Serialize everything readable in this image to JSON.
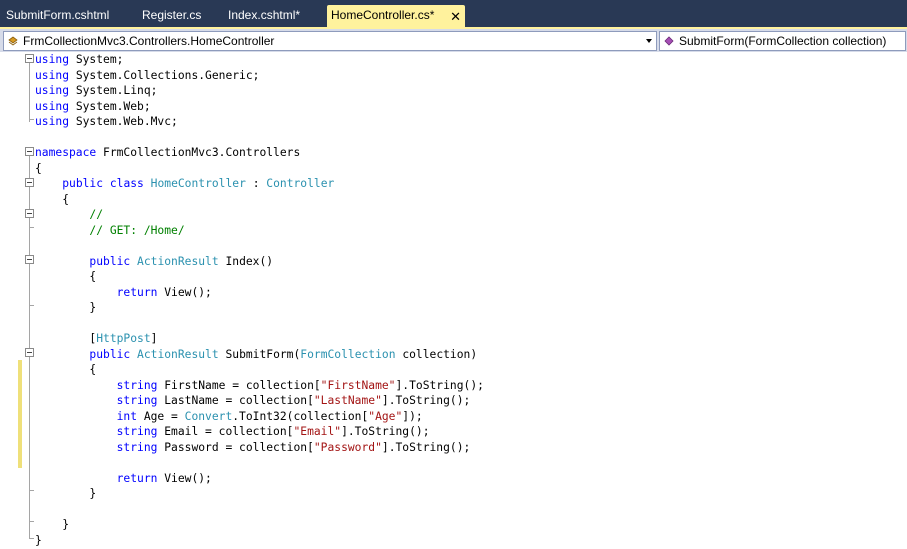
{
  "tabs": [
    {
      "label": "SubmitForm.cshtml",
      "active": false
    },
    {
      "label": "Register.cs",
      "active": false
    },
    {
      "label": "Index.cshtml*",
      "active": false
    },
    {
      "label": "HomeController.cs*",
      "active": true
    }
  ],
  "tab_close_glyph": "✕",
  "navbar": {
    "type_combo": "FrmCollectionMvc3.Controllers.HomeController",
    "member_combo": "SubmitForm(FormCollection collection)"
  },
  "icons": {
    "type_combo": "class-icon",
    "member_combo": "method-icon"
  },
  "colors": {
    "keyword": "#0000ff",
    "type": "#2b91af",
    "comment": "#008000",
    "string": "#a31515",
    "active_tab": "#fff29d",
    "tab_strip": "#293955"
  },
  "code_lines": [
    [
      {
        "t": "using",
        "c": "kw"
      },
      {
        "t": " System;"
      }
    ],
    [
      {
        "t": "using",
        "c": "kw"
      },
      {
        "t": " System.Collections.Generic;"
      }
    ],
    [
      {
        "t": "using",
        "c": "kw"
      },
      {
        "t": " System.Linq;"
      }
    ],
    [
      {
        "t": "using",
        "c": "kw"
      },
      {
        "t": " System.Web;"
      }
    ],
    [
      {
        "t": "using",
        "c": "kw"
      },
      {
        "t": " System.Web.Mvc;"
      }
    ],
    [],
    [
      {
        "t": "namespace",
        "c": "kw"
      },
      {
        "t": " FrmCollectionMvc3.Controllers"
      }
    ],
    [
      {
        "t": "{"
      }
    ],
    [
      {
        "t": "    "
      },
      {
        "t": "public",
        "c": "kw"
      },
      {
        "t": " "
      },
      {
        "t": "class",
        "c": "kw"
      },
      {
        "t": " "
      },
      {
        "t": "HomeController",
        "c": "ty"
      },
      {
        "t": " : "
      },
      {
        "t": "Controller",
        "c": "ty"
      }
    ],
    [
      {
        "t": "    {"
      }
    ],
    [
      {
        "t": "        "
      },
      {
        "t": "//",
        "c": "cm"
      }
    ],
    [
      {
        "t": "        "
      },
      {
        "t": "// GET: /Home/",
        "c": "cm"
      }
    ],
    [],
    [
      {
        "t": "        "
      },
      {
        "t": "public",
        "c": "kw"
      },
      {
        "t": " "
      },
      {
        "t": "ActionResult",
        "c": "ty"
      },
      {
        "t": " Index()"
      }
    ],
    [
      {
        "t": "        {"
      }
    ],
    [
      {
        "t": "            "
      },
      {
        "t": "return",
        "c": "kw"
      },
      {
        "t": " View();"
      }
    ],
    [
      {
        "t": "        }"
      }
    ],
    [],
    [
      {
        "t": "        ["
      },
      {
        "t": "HttpPost",
        "c": "ty"
      },
      {
        "t": "]"
      }
    ],
    [
      {
        "t": "        "
      },
      {
        "t": "public",
        "c": "kw"
      },
      {
        "t": " "
      },
      {
        "t": "ActionResult",
        "c": "ty"
      },
      {
        "t": " SubmitForm("
      },
      {
        "t": "FormCollection",
        "c": "ty"
      },
      {
        "t": " collection)"
      }
    ],
    [
      {
        "t": "        {"
      }
    ],
    [
      {
        "t": "            "
      },
      {
        "t": "string",
        "c": "kw"
      },
      {
        "t": " FirstName = collection["
      },
      {
        "t": "\"FirstName\"",
        "c": "st"
      },
      {
        "t": "].ToString();"
      }
    ],
    [
      {
        "t": "            "
      },
      {
        "t": "string",
        "c": "kw"
      },
      {
        "t": " LastName = collection["
      },
      {
        "t": "\"LastName\"",
        "c": "st"
      },
      {
        "t": "].ToString();"
      }
    ],
    [
      {
        "t": "            "
      },
      {
        "t": "int",
        "c": "kw"
      },
      {
        "t": " Age = "
      },
      {
        "t": "Convert",
        "c": "ty"
      },
      {
        "t": ".ToInt32(collection["
      },
      {
        "t": "\"Age\"",
        "c": "st"
      },
      {
        "t": "]);"
      }
    ],
    [
      {
        "t": "            "
      },
      {
        "t": "string",
        "c": "kw"
      },
      {
        "t": " Email = collection["
      },
      {
        "t": "\"Email\"",
        "c": "st"
      },
      {
        "t": "].ToString();"
      }
    ],
    [
      {
        "t": "            "
      },
      {
        "t": "string",
        "c": "kw"
      },
      {
        "t": " Password = collection["
      },
      {
        "t": "\"Password\"",
        "c": "st"
      },
      {
        "t": "].ToString();"
      }
    ],
    [],
    [
      {
        "t": "            "
      },
      {
        "t": "return",
        "c": "kw"
      },
      {
        "t": " View();"
      }
    ],
    [
      {
        "t": "        }"
      }
    ],
    [],
    [
      {
        "t": "    }"
      }
    ],
    [
      {
        "t": "}"
      }
    ]
  ]
}
